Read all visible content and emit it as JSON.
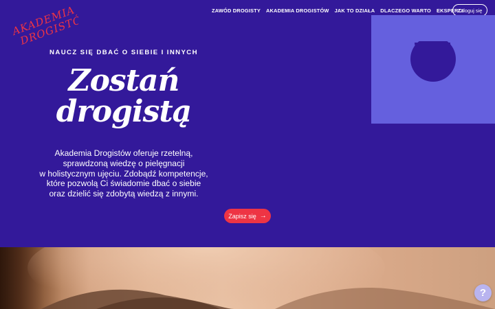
{
  "brand": {
    "logo_line1": "AKADEMIA",
    "logo_line2": "DROGISTÓW",
    "logo_color": "#ee3444"
  },
  "nav": {
    "items": [
      {
        "label": "ZAWÓD DROGISTY"
      },
      {
        "label": "AKADEMIA DROGISTÓW"
      },
      {
        "label": "JAK TO DZIAŁA"
      },
      {
        "label": "DLACZEGO WARTO"
      },
      {
        "label": "EKSPERCI"
      }
    ],
    "login_label": "Zaloguj się"
  },
  "hero": {
    "eyebrow": "NAUCZ SIĘ DBAĆ O SIEBIE I INNYCH",
    "title_line1": "Zostań",
    "title_line2": "drogistą",
    "description_lines": [
      "Akademia Drogistów oferuje rzetelną,",
      "sprawdzoną wiedzę o pielęgnacji",
      "w holistycznym ujęciu. Zdobądź kompetencje,",
      "które pozwolą Ci świadomie dbać o siebie",
      "oraz dzielić się zdobytą wiedzą z innymi."
    ],
    "cta_label": "Zapisz się",
    "cta_icon": "arrow-right-icon"
  },
  "help": {
    "label": "?"
  },
  "colors": {
    "background": "#33199a",
    "deco_block": "#6560de",
    "deco_shape": "#33199a",
    "accent": "#ee3444",
    "help_bubble": "#b9b4ef"
  }
}
